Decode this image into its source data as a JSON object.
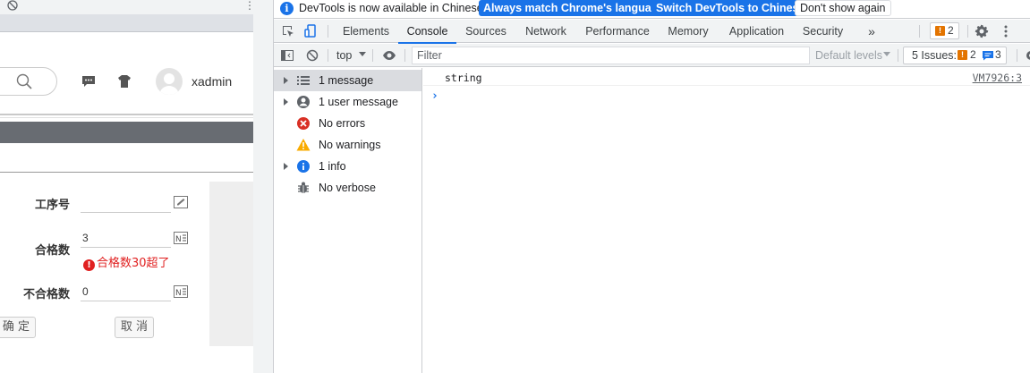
{
  "app": {
    "user": {
      "name": "xadmin"
    },
    "form": {
      "process_label": "工序号",
      "process_value": "",
      "qualified_label": "合格数",
      "qualified_value": "3",
      "qualified_error": "合格数30超了",
      "unqualified_label": "不合格数",
      "unqualified_value": "0",
      "confirm_label": "确 定",
      "cancel_label": "取 消"
    }
  },
  "devtools": {
    "infobar": {
      "message": "DevTools is now available in Chinese!",
      "btn_match": "Always match Chrome's language",
      "btn_switch": "Switch DevTools to Chinese",
      "btn_dismiss": "Don't show again"
    },
    "tabs": [
      "Elements",
      "Console",
      "Sources",
      "Network",
      "Performance",
      "Memory",
      "Application",
      "Security"
    ],
    "active_tab": "Console",
    "more_tabs": "»",
    "warning_badge_count": "2",
    "toolbar": {
      "context": "top",
      "filter_placeholder": "Filter",
      "levels": "Default levels",
      "issues_label": "5 Issues:",
      "issues_warn": "2",
      "issues_info": "3"
    },
    "sidebar": [
      {
        "label": "1 message",
        "icon": "list-icon",
        "expandable": true,
        "selected": true
      },
      {
        "label": "1 user message",
        "icon": "user-icon",
        "expandable": true,
        "selected": false
      },
      {
        "label": "No errors",
        "icon": "error-icon",
        "expandable": false,
        "selected": false
      },
      {
        "label": "No warnings",
        "icon": "warning-icon",
        "expandable": false,
        "selected": false
      },
      {
        "label": "1 info",
        "icon": "info-icon",
        "expandable": true,
        "selected": false
      },
      {
        "label": "No verbose",
        "icon": "bug-icon",
        "expandable": false,
        "selected": false
      }
    ],
    "console": {
      "log": {
        "text": "string",
        "source": "VM7926:3"
      },
      "prompt": "›"
    },
    "colors": {
      "accent": "#1a73e8",
      "warning": "#e37400",
      "error": "#d93025"
    }
  }
}
